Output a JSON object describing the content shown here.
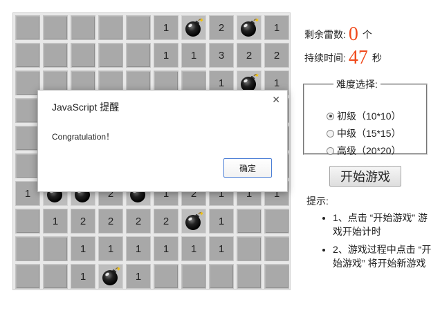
{
  "board": {
    "rows": [
      [
        "c",
        "c",
        "c",
        "c",
        "c",
        "1",
        "B",
        "2",
        "B",
        "1"
      ],
      [
        "c",
        "c",
        "c",
        "c",
        "c",
        "1",
        "1",
        "3",
        "2",
        "2"
      ],
      [
        "c",
        "c",
        "c",
        "c",
        "c",
        "c",
        "c",
        "1",
        "B",
        "1"
      ],
      [
        "c",
        "c",
        "c",
        "c",
        "c",
        "c",
        "c",
        "c",
        "c",
        "c"
      ],
      [
        "c",
        "c",
        "c",
        "c",
        "c",
        "c",
        "c",
        "c",
        "c",
        "c"
      ],
      [
        "c",
        "c",
        "c",
        "c",
        "c",
        "c",
        "c",
        "c",
        "c",
        "c"
      ],
      [
        "1",
        "B",
        "B",
        "2",
        "B",
        "1",
        "2",
        "1",
        "1",
        "1"
      ],
      [
        "c",
        "1",
        "2",
        "2",
        "2",
        "2",
        "B",
        "1",
        "c",
        "c"
      ],
      [
        "c",
        "c",
        "1",
        "1",
        "1",
        "1",
        "1",
        "1",
        "c",
        "c"
      ],
      [
        "c",
        "c",
        "1",
        "B",
        "1",
        "c",
        "c",
        "c",
        "c",
        "c"
      ]
    ],
    "bomb_icon": "bomb-icon"
  },
  "status": {
    "mines_label": "剩余雷数:",
    "mines_value": "0",
    "mines_unit": "个",
    "time_label": "持续时间:",
    "time_value": "47",
    "time_unit": "秒"
  },
  "difficulty": {
    "legend": "难度选择:",
    "options": [
      {
        "label": "初级（10*10）",
        "checked": true
      },
      {
        "label": "中级（15*15）",
        "checked": false
      },
      {
        "label": "高级（20*20）",
        "checked": false
      }
    ]
  },
  "start_button": "开始游戏",
  "tips": {
    "title": "提示:",
    "items": [
      "1、点击 “开始游戏” 游戏开始计时",
      "2、游戏过程中点击 “开始游戏” 将开始新游戏"
    ]
  },
  "dialog": {
    "title": "JavaScript 提醒",
    "close_icon": "close-icon",
    "message": "Congratulation！",
    "ok_label": "确定"
  },
  "colors": {
    "accent_number": "#f04a1c",
    "cell_covered": "#a9a9a9",
    "dialog_button_border": "#4c7fd6"
  }
}
